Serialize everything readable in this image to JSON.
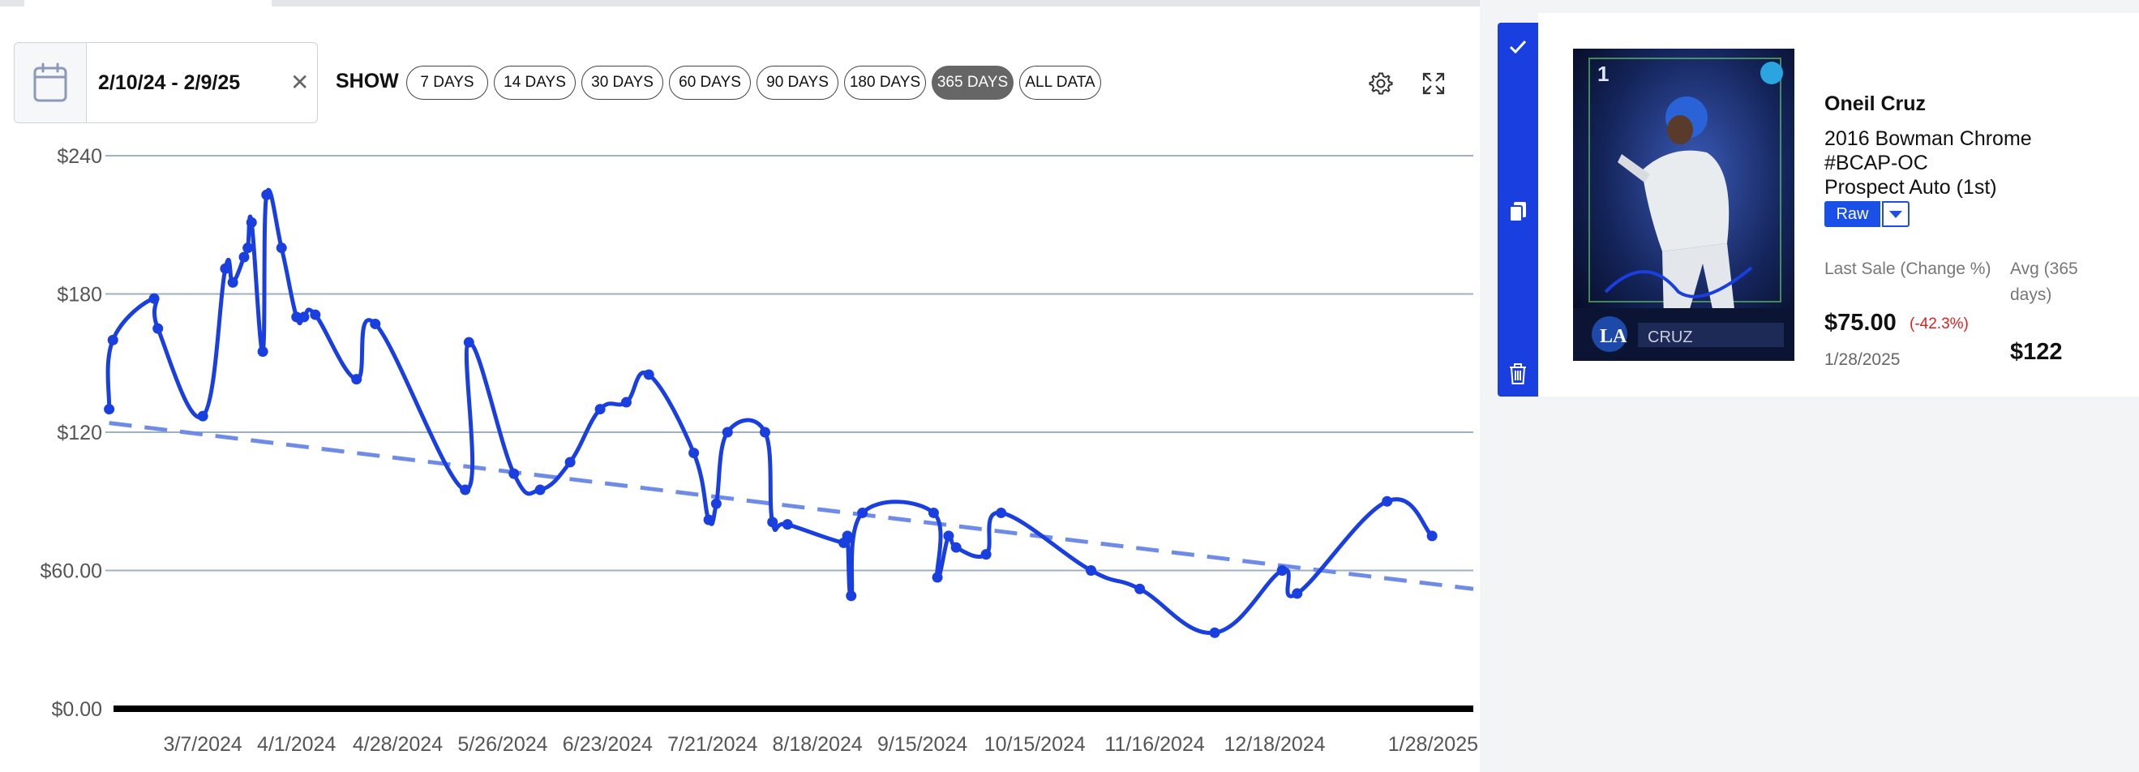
{
  "date_range": {
    "text": "2/10/24 - 2/9/25"
  },
  "show_label": "SHOW",
  "range_buttons": [
    "7 DAYS",
    "14 DAYS",
    "30 DAYS",
    "60 DAYS",
    "90 DAYS",
    "180 DAYS",
    "365 DAYS",
    "ALL DATA"
  ],
  "active_range": "365 DAYS",
  "icons": {
    "calendar": "calendar-icon",
    "clear": "close-icon",
    "settings": "gear-icon",
    "expand": "expand-icon",
    "select": "check-icon",
    "copy": "copy-icon",
    "delete": "trash-icon",
    "dropdown": "chevron-down-icon"
  },
  "card": {
    "player": "Oneil Cruz",
    "set_line1": "2016 Bowman Chrome",
    "set_line2": "#BCAP-OC",
    "set_line3": "Prospect Auto (1st)",
    "grade": "Raw",
    "last_sale_label": "Last Sale (Change %)",
    "last_sale_value": "$75.00",
    "last_sale_change": "(-42.3%)",
    "last_sale_date": "1/28/2025",
    "avg_label": "Avg (365 days)",
    "avg_value": "$122"
  },
  "colors": {
    "series": "#1a3fe0",
    "trend": "#6f8be8",
    "accent": "#1a3fe0",
    "negative": "#e01e1e",
    "active_button": "#666666"
  },
  "chart_data": {
    "type": "line",
    "y_tick_labels": [
      "$0.00",
      "$60.00",
      "$120",
      "$180",
      "$240"
    ],
    "y_ticks": [
      0,
      60,
      120,
      180,
      240
    ],
    "ylim": [
      0,
      240
    ],
    "x_tick_labels": [
      "3/7/2024",
      "4/1/2024",
      "4/28/2024",
      "5/26/2024",
      "6/23/2024",
      "7/21/2024",
      "8/18/2024",
      "9/15/2024",
      "10/15/2024",
      "11/16/2024",
      "12/18/2024",
      "1/28/2025"
    ],
    "x_tick_dates": [
      "2024-03-07",
      "2024-04-01",
      "2024-04-28",
      "2024-05-26",
      "2024-06-23",
      "2024-07-21",
      "2024-08-18",
      "2024-09-15",
      "2024-10-15",
      "2024-11-16",
      "2024-12-18",
      "2025-01-28"
    ],
    "xlim": [
      "2024-02-10",
      "2025-02-09"
    ],
    "grid": true,
    "series": [
      {
        "points": [
          [
            "2024-02-11",
            130
          ],
          [
            "2024-02-12",
            160
          ],
          [
            "2024-02-23",
            178
          ],
          [
            "2024-02-24",
            165
          ],
          [
            "2024-03-07",
            127
          ],
          [
            "2024-03-13",
            191
          ],
          [
            "2024-03-15",
            185
          ],
          [
            "2024-03-18",
            196
          ],
          [
            "2024-03-19",
            200
          ],
          [
            "2024-03-20",
            211
          ],
          [
            "2024-03-23",
            155
          ],
          [
            "2024-03-24",
            223
          ],
          [
            "2024-03-28",
            200
          ],
          [
            "2024-04-01",
            170
          ],
          [
            "2024-04-03",
            170
          ],
          [
            "2024-04-06",
            171
          ],
          [
            "2024-04-17",
            143
          ],
          [
            "2024-04-22",
            167
          ],
          [
            "2024-05-16",
            95
          ],
          [
            "2024-05-17",
            159
          ],
          [
            "2024-05-29",
            102
          ],
          [
            "2024-06-05",
            95
          ],
          [
            "2024-06-13",
            107
          ],
          [
            "2024-06-21",
            130
          ],
          [
            "2024-06-28",
            133
          ],
          [
            "2024-07-04",
            145
          ],
          [
            "2024-07-16",
            111
          ],
          [
            "2024-07-20",
            82
          ],
          [
            "2024-07-22",
            89
          ],
          [
            "2024-07-25",
            120
          ],
          [
            "2024-08-04",
            120
          ],
          [
            "2024-08-06",
            81
          ],
          [
            "2024-08-10",
            80
          ],
          [
            "2024-08-25",
            72
          ],
          [
            "2024-08-26",
            75
          ],
          [
            "2024-08-27",
            49
          ],
          [
            "2024-08-30",
            85
          ],
          [
            "2024-09-18",
            85
          ],
          [
            "2024-09-19",
            57
          ],
          [
            "2024-09-22",
            75
          ],
          [
            "2024-09-24",
            70
          ],
          [
            "2024-10-02",
            67
          ],
          [
            "2024-10-06",
            85
          ],
          [
            "2024-10-30",
            60
          ],
          [
            "2024-11-12",
            52
          ],
          [
            "2024-12-02",
            33
          ],
          [
            "2024-12-20",
            60
          ],
          [
            "2024-12-24",
            50
          ],
          [
            "2025-01-17",
            90
          ],
          [
            "2025-01-29",
            75
          ]
        ]
      }
    ],
    "trendline": {
      "start": [
        "2024-02-11",
        124
      ],
      "end": [
        "2025-02-09",
        52
      ]
    }
  }
}
